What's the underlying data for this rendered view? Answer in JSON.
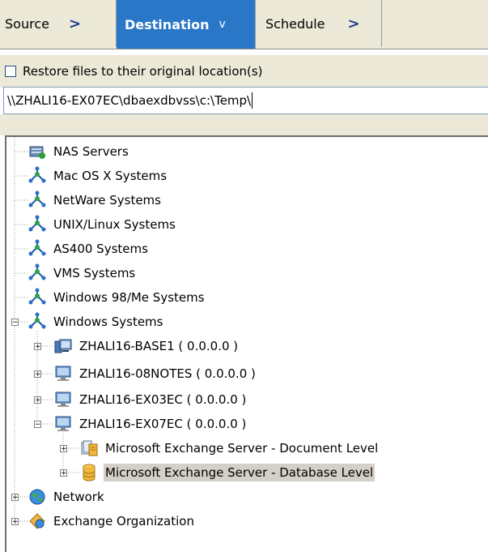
{
  "tabs": [
    {
      "label": "Source",
      "chevron": ">"
    },
    {
      "label": "Destination",
      "chevron": "v"
    },
    {
      "label": "Schedule",
      "chevron": ">"
    }
  ],
  "options": {
    "restore_original_label": "Restore files to their original location(s)",
    "restore_original_checked": false
  },
  "path": {
    "value": "\\\\ZHALI16-EX07EC\\dbaexdbvss\\c:\\Temp\\"
  },
  "tree": {
    "nodes": [
      {
        "label": "NAS Servers",
        "icon": "nas-server-icon"
      },
      {
        "label": "Mac OS X Systems",
        "icon": "network-system-icon"
      },
      {
        "label": "NetWare Systems",
        "icon": "network-system-icon"
      },
      {
        "label": "UNIX/Linux Systems",
        "icon": "network-system-icon"
      },
      {
        "label": "AS400 Systems",
        "icon": "network-system-icon"
      },
      {
        "label": "VMS Systems",
        "icon": "network-system-icon"
      },
      {
        "label": "Windows 98/Me Systems",
        "icon": "network-system-icon"
      },
      {
        "label": "Windows Systems",
        "icon": "network-system-icon",
        "expanded": true
      },
      {
        "label": "ZHALI16-BASE1 ( 0.0.0.0 )",
        "icon": "server-icon"
      },
      {
        "label": "ZHALI16-08NOTES ( 0.0.0.0 )",
        "icon": "computer-icon"
      },
      {
        "label": "ZHALI16-EX03EC ( 0.0.0.0 )",
        "icon": "computer-icon"
      },
      {
        "label": "ZHALI16-EX07EC ( 0.0.0.0 )",
        "icon": "computer-icon",
        "expanded": true
      },
      {
        "label": "Microsoft Exchange Server - Document Level",
        "icon": "exchange-document-icon"
      },
      {
        "label": "Microsoft Exchange Server - Database Level",
        "icon": "database-icon",
        "selected": true
      },
      {
        "label": "Network",
        "icon": "network-globe-icon"
      },
      {
        "label": "Exchange Organization",
        "icon": "exchange-organization-icon"
      }
    ]
  },
  "colors": {
    "active_tab": "#2a77c8",
    "selection": "#d4d0c8",
    "panel": "#ece9d8"
  }
}
